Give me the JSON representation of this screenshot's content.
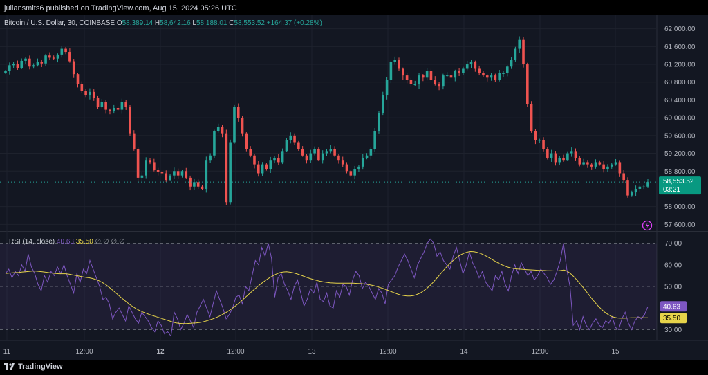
{
  "header": {
    "published": "juliansmits6 published on TradingView.com, Aug 15, 2024 05:26 UTC"
  },
  "symbol": {
    "name": "Bitcoin / U.S. Dollar, 30, COINBASE",
    "o_label": "O",
    "o": "58,389.14",
    "h_label": "H",
    "h": "58,642.16",
    "l_label": "L",
    "l": "58,188.01",
    "c_label": "C",
    "c": "58,553.52",
    "change": "+164.37 (+0.28%)"
  },
  "price_tag": {
    "price": "58,553.52",
    "countdown": "03:21"
  },
  "rsi_legend": {
    "label": "RSI (14, close)",
    "rsi": "40.63",
    "ma": "35.50",
    "na": "∅ ∅ ∅ ∅"
  },
  "rsi_tags": {
    "rsi": "40.63",
    "ma": "35.50"
  },
  "footer": {
    "brand": "TradingView"
  },
  "colors": {
    "up": "#26a69a",
    "down": "#ef5350",
    "rsi": "#7e57c2",
    "rsi_ma": "#e6d34a",
    "bg": "#131722"
  },
  "chart_data": [
    {
      "type": "candlestick",
      "title": "Bitcoin / U.S. Dollar, 30, COINBASE",
      "price_ticks": [
        62000,
        61600,
        61200,
        60800,
        60400,
        60000,
        59600,
        59200,
        58800,
        58000,
        57600
      ],
      "price_tick_labels": [
        "62,000.00",
        "61,600.00",
        "61,200.00",
        "60,800.00",
        "60,400.00",
        "60,000.00",
        "59,600.00",
        "59,200.00",
        "58,800.00",
        "58,000.00",
        "57,600.00"
      ],
      "ylim": [
        57450,
        62150
      ],
      "time_ticks": [
        "11",
        "12:00",
        "12",
        "12:00",
        "13",
        "12:00",
        "14",
        "12:00",
        "15"
      ],
      "bold_ticks": [
        "12"
      ],
      "last_price": 58553.52,
      "closes": [
        61050,
        61180,
        61210,
        61120,
        61280,
        61330,
        61150,
        61180,
        61250,
        61220,
        61400,
        61350,
        61330,
        61420,
        61550,
        61480,
        61270,
        60980,
        60750,
        60600,
        60500,
        60580,
        60450,
        60250,
        60350,
        60180,
        60150,
        60220,
        60180,
        60350,
        60250,
        59650,
        59300,
        58650,
        58700,
        59050,
        59000,
        58820,
        58780,
        58750,
        58600,
        58700,
        58800,
        58700,
        58800,
        58650,
        58450,
        58550,
        58450,
        58400,
        59050,
        59150,
        59700,
        59800,
        59650,
        58100,
        59450,
        60250,
        60000,
        59650,
        59300,
        59150,
        58950,
        58750,
        58950,
        58850,
        59050,
        59100,
        59000,
        59250,
        59500,
        59600,
        59450,
        59300,
        59150,
        59050,
        59200,
        59300,
        59050,
        59200,
        59250,
        59300,
        59150,
        59050,
        58950,
        58800,
        58700,
        58850,
        58900,
        59100,
        59150,
        59300,
        59700,
        60100,
        60500,
        60850,
        61250,
        61300,
        61100,
        60950,
        60850,
        60750,
        60750,
        60950,
        60900,
        61050,
        60850,
        60750,
        60700,
        60950,
        60950,
        60900,
        61050,
        61000,
        61100,
        61200,
        61250,
        61100,
        61000,
        60950,
        60900,
        60950,
        60850,
        61000,
        61000,
        61150,
        61300,
        61550,
        61750,
        61200,
        60300,
        59700,
        59500,
        59500,
        59300,
        59100,
        59200,
        59000,
        59100,
        59050,
        59200,
        59250,
        59100,
        58950,
        59000,
        58950,
        58900,
        59000,
        58950,
        58850,
        58900,
        58950,
        59000,
        58750,
        58600,
        58250,
        58320,
        58400,
        58450,
        58450,
        58553
      ]
    },
    {
      "type": "line",
      "title": "RSI (14, close)",
      "ylim": [
        25,
        75
      ],
      "y_ticks": [
        70,
        60,
        50,
        40,
        30
      ],
      "y_tick_labels": [
        "70.00",
        "60.00",
        "50.00",
        "40.00",
        "30.00"
      ],
      "bands": [
        70,
        50,
        30
      ],
      "series": [
        {
          "name": "RSI",
          "values": [
            56,
            58,
            54,
            57,
            55,
            60,
            57,
            65,
            59,
            56,
            51,
            48,
            55,
            52,
            57,
            55,
            59,
            56,
            60,
            55,
            51,
            47,
            56,
            52,
            58,
            56,
            62,
            58,
            54,
            50,
            44,
            45,
            42,
            35,
            38,
            40,
            37,
            34,
            41,
            38,
            35,
            33,
            38,
            36,
            34,
            31,
            29,
            34,
            32,
            28,
            29,
            27,
            38,
            35,
            30,
            33,
            37,
            34,
            31,
            38,
            41,
            44,
            40,
            36,
            42,
            48,
            44,
            40,
            35,
            37,
            40,
            45,
            46,
            42,
            50,
            48,
            55,
            62,
            60,
            68,
            64,
            70,
            63,
            45,
            54,
            56,
            51,
            48,
            44,
            50,
            53,
            47,
            41,
            44,
            49,
            47,
            52,
            44,
            43,
            47,
            41,
            40,
            48,
            45,
            51,
            50,
            46,
            53,
            57,
            55,
            49,
            52,
            50,
            47,
            44,
            49,
            47,
            42,
            51,
            53,
            55,
            59,
            62,
            65,
            62,
            58,
            54,
            60,
            63,
            66,
            70,
            72,
            70,
            64,
            66,
            62,
            60,
            58,
            64,
            68,
            62,
            56,
            60,
            66,
            61,
            58,
            54,
            57,
            52,
            50,
            48,
            55,
            53,
            57,
            51,
            48,
            55,
            60,
            56,
            61,
            58,
            55,
            57,
            53,
            55,
            58,
            56,
            54,
            51,
            53,
            57,
            62,
            70,
            58,
            50,
            32,
            34,
            30,
            36,
            32,
            30,
            33,
            35,
            32,
            31,
            34,
            33,
            36,
            31,
            30,
            35,
            38,
            33,
            30,
            34,
            36,
            35,
            37,
            40.63
          ]
        },
        {
          "name": "MA",
          "values": [
            56,
            56.2,
            56.3,
            56.4,
            56.5,
            56.7,
            56.8,
            57,
            57.1,
            57.1,
            57,
            56.8,
            56.6,
            56.4,
            56.2,
            56,
            55.9,
            55.9,
            55.9,
            55.7,
            55.4,
            55.1,
            54.8,
            54.5,
            54.2,
            54,
            53.7,
            53.2,
            52.6,
            51.8,
            50.8,
            49.6,
            48.3,
            47,
            45.6,
            44.3,
            43,
            41.8,
            40.7,
            39.7,
            38.9,
            38.2,
            37.6,
            37,
            36.5,
            36,
            35.5,
            35,
            34.5,
            34,
            33.5,
            33.1,
            32.9,
            32.8,
            32.8,
            32.9,
            33,
            33.1,
            33.3,
            33.6,
            34,
            34.5,
            35,
            35.6,
            36.3,
            37.1,
            38,
            39,
            40.1,
            41.3,
            42.6,
            44,
            45.4,
            46.8,
            48.2,
            49.5,
            50.8,
            52,
            53.1,
            54.1,
            55,
            55.8,
            56.4,
            56.7,
            56.8,
            56.6,
            56.3,
            55.9,
            55.4,
            54.8,
            54.2,
            53.7,
            53.2,
            52.8,
            52.4,
            52.1,
            51.9,
            51.7,
            51.6,
            51.5,
            51.5,
            51.5,
            51.5,
            51.5,
            51.5,
            51.4,
            51.3,
            51.2,
            51,
            50.7,
            50.4,
            50,
            49.5,
            49,
            48.4,
            47.8,
            47.2,
            46.6,
            46.1,
            45.8,
            45.6,
            45.6,
            45.8,
            46.3,
            47,
            48,
            49.2,
            50.6,
            52.2,
            54,
            55.8,
            57.6,
            59.3,
            60.9,
            62.3,
            63.6,
            64.6,
            65.4,
            65.9,
            66.2,
            66.1,
            65.8,
            65.3,
            64.6,
            63.8,
            62.9,
            62,
            61.1,
            60.3,
            59.6,
            59,
            58.6,
            58.3,
            58.1,
            58,
            57.9,
            57.8,
            57.7,
            57.6,
            57.5,
            57.4,
            57.4,
            57.3,
            57.3,
            57.2,
            57.2,
            57.4,
            57.6,
            57,
            55.8,
            54.3,
            52.6,
            50.8,
            48.9,
            46.9,
            44.9,
            43,
            41.2,
            39.6,
            38.2,
            37.1,
            36.2,
            35.7,
            35.4,
            35.3,
            35.3,
            35.4,
            35.5,
            35.5,
            35.5,
            35.5,
            35.5,
            35.5
          ]
        }
      ]
    }
  ]
}
